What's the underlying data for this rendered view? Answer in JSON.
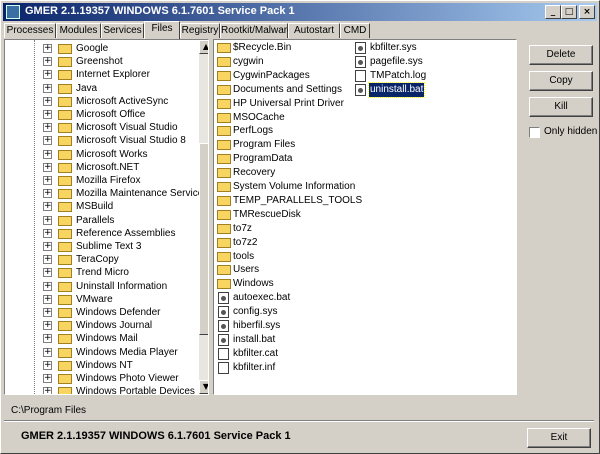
{
  "window": {
    "title": "GMER 2.1.19357     WINDOWS 6.1.7601 Service Pack 1",
    "minimize": "_",
    "maximize": "□",
    "close": "×"
  },
  "tabs": [
    "Processes",
    "Modules",
    "Services",
    "Files",
    "Registry",
    "Rootkit/Malware",
    "Autostart",
    "CMD"
  ],
  "active_tab": "Files",
  "tree": {
    "items": [
      "Google",
      "Greenshot",
      "Internet Explorer",
      "Java",
      "Microsoft ActiveSync",
      "Microsoft Office",
      "Microsoft Visual Studio",
      "Microsoft Visual Studio 8",
      "Microsoft Works",
      "Microsoft.NET",
      "Mozilla Firefox",
      "Mozilla Maintenance Service",
      "MSBuild",
      "Parallels",
      "Reference Assemblies",
      "Sublime Text 3",
      "TeraCopy",
      "Trend Micro",
      "Uninstall Information",
      "VMware",
      "Windows Defender",
      "Windows Journal",
      "Windows Mail",
      "Windows Media Player",
      "Windows NT",
      "Windows Photo Viewer",
      "Windows Portable Devices"
    ],
    "expander": "+"
  },
  "files": {
    "column1": [
      {
        "name": "$Recycle.Bin",
        "type": "folder"
      },
      {
        "name": "cygwin",
        "type": "folder"
      },
      {
        "name": "CygwinPackages",
        "type": "folder"
      },
      {
        "name": "Documents and Settings",
        "type": "folder"
      },
      {
        "name": "HP Universal Print Driver",
        "type": "folder"
      },
      {
        "name": "MSOCache",
        "type": "folder"
      },
      {
        "name": "PerfLogs",
        "type": "folder"
      },
      {
        "name": "Program Files",
        "type": "folder"
      },
      {
        "name": "ProgramData",
        "type": "folder"
      },
      {
        "name": "Recovery",
        "type": "folder"
      },
      {
        "name": "System Volume Information",
        "type": "folder"
      },
      {
        "name": "TEMP_PARALLELS_TOOLS",
        "type": "folder"
      },
      {
        "name": "TMRescueDisk",
        "type": "folder"
      },
      {
        "name": "to7z",
        "type": "folder"
      },
      {
        "name": "to7z2",
        "type": "folder"
      },
      {
        "name": "tools",
        "type": "folder"
      },
      {
        "name": "Users",
        "type": "folder"
      },
      {
        "name": "Windows",
        "type": "folder"
      },
      {
        "name": "autoexec.bat",
        "type": "gear"
      },
      {
        "name": "config.sys",
        "type": "gear"
      },
      {
        "name": "hiberfil.sys",
        "type": "gear"
      },
      {
        "name": "install.bat",
        "type": "gear"
      },
      {
        "name": "kbfilter.cat",
        "type": "doc"
      },
      {
        "name": "kbfilter.inf",
        "type": "doc"
      }
    ],
    "column2": [
      {
        "name": "kbfilter.sys",
        "type": "gear"
      },
      {
        "name": "pagefile.sys",
        "type": "gear"
      },
      {
        "name": "TMPatch.log",
        "type": "doc"
      },
      {
        "name": "uninstall.bat",
        "type": "gear",
        "selected": true
      }
    ]
  },
  "buttons": {
    "delete": "Delete",
    "copy": "Copy",
    "kill": "Kill",
    "only_hidden": "Only hidden",
    "exit": "Exit"
  },
  "path": "C:\\Program Files",
  "status": "GMER 2.1.19357     WINDOWS 6.1.7601 Service Pack 1",
  "colors": {
    "titlebar_start": "#0a246a",
    "titlebar_end": "#a6caf0",
    "selection": "#0a246a",
    "face": "#d4d0c8"
  }
}
